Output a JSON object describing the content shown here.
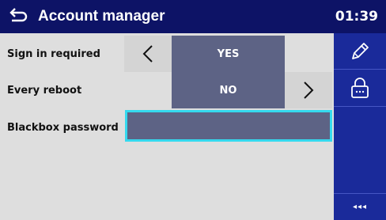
{
  "header": {
    "title": "Account manager",
    "time": "01:39",
    "back_icon": "back-arrow-icon"
  },
  "settings": [
    {
      "label": "Sign in required",
      "value": "YES",
      "has_prev": true,
      "has_next": false
    },
    {
      "label": "Every reboot",
      "value": "NO",
      "has_prev": false,
      "has_next": true
    },
    {
      "label": "Blackbox password",
      "value": ""
    }
  ],
  "sidebar": {
    "edit_icon": "pencil-icon",
    "lock_icon": "lock-icon",
    "more_label": "◂◂◂"
  },
  "colors": {
    "header_bg": "#0d1366",
    "sidebar_bg": "#1a2a9a",
    "content_bg": "#dedede",
    "value_bg": "#5d6385",
    "focus_border": "#35d9ee"
  }
}
